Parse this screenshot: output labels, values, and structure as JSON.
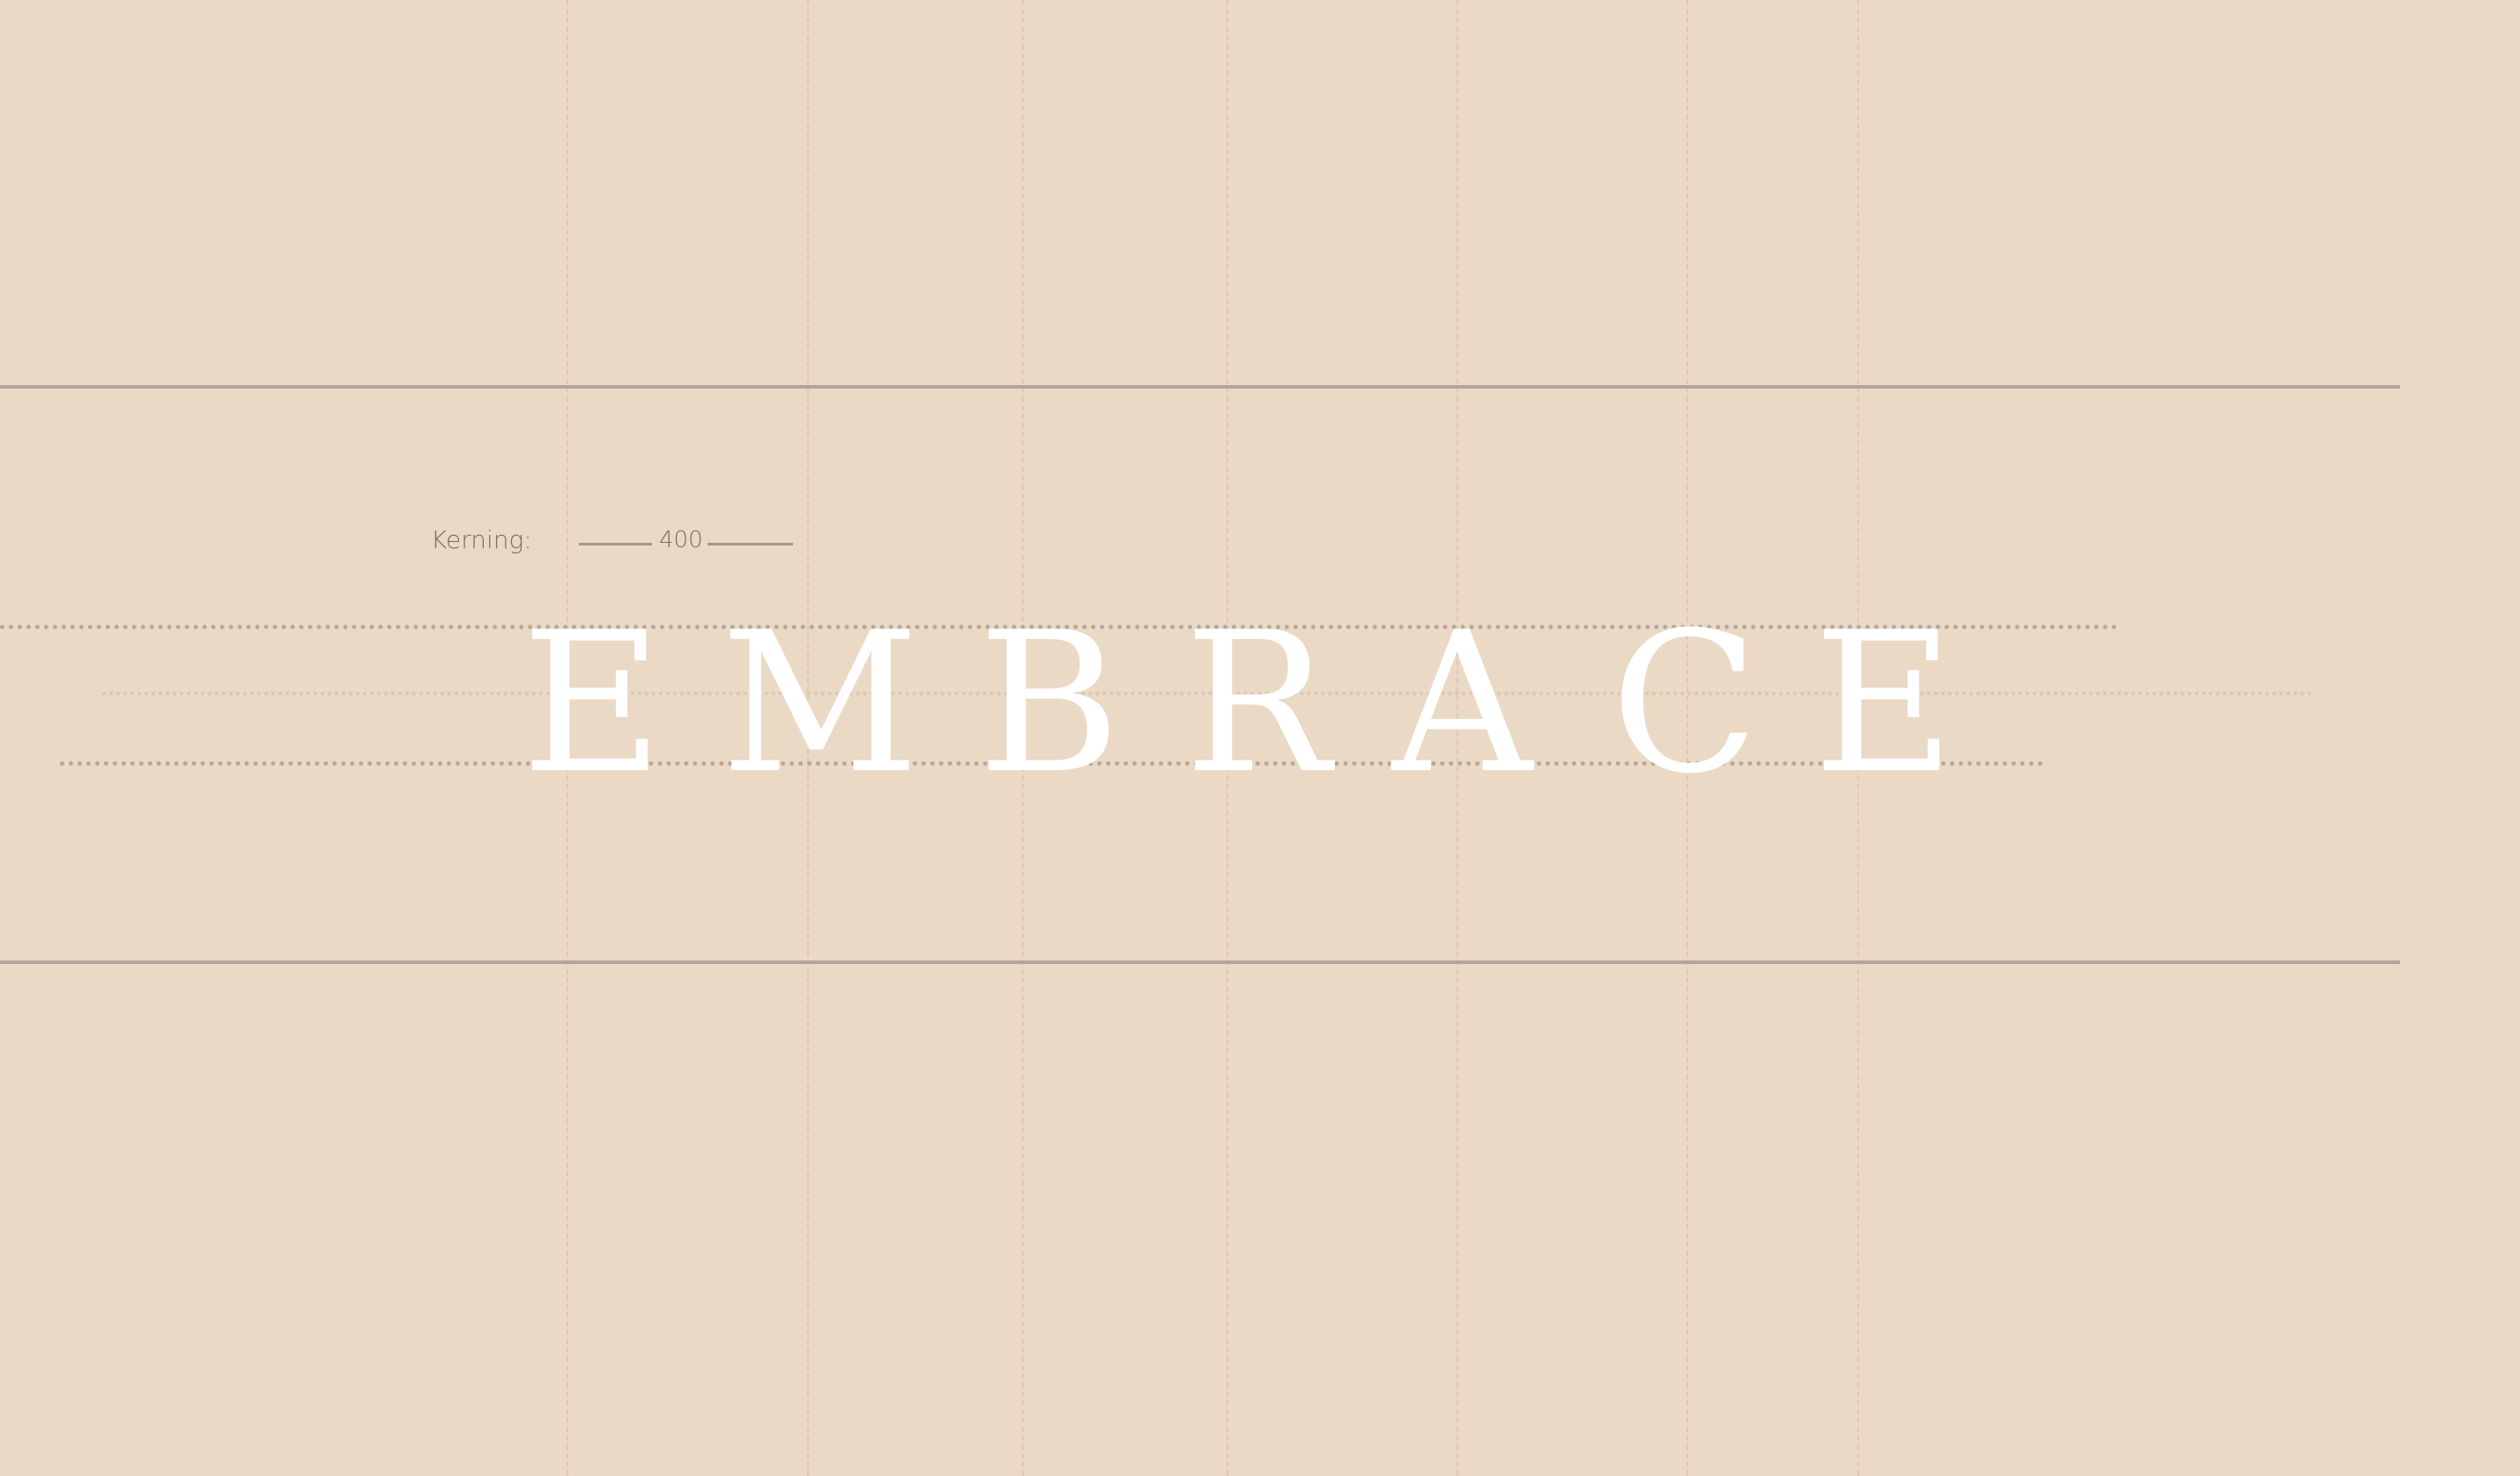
{
  "kerning": {
    "label": "Kerning:",
    "value": "400"
  },
  "word": {
    "text": "EMBRACE",
    "letters": [
      "E",
      "M",
      "B",
      "R",
      "A",
      "C",
      "E"
    ]
  },
  "colors": {
    "background": "#EAD9C5",
    "guide_line": "#B4A39E",
    "dotted_line": "#B8A6A0",
    "light_dotted_line": "#D9C7B5",
    "text_muted": "#7F6B67",
    "word_color": "#FFFFFF"
  }
}
